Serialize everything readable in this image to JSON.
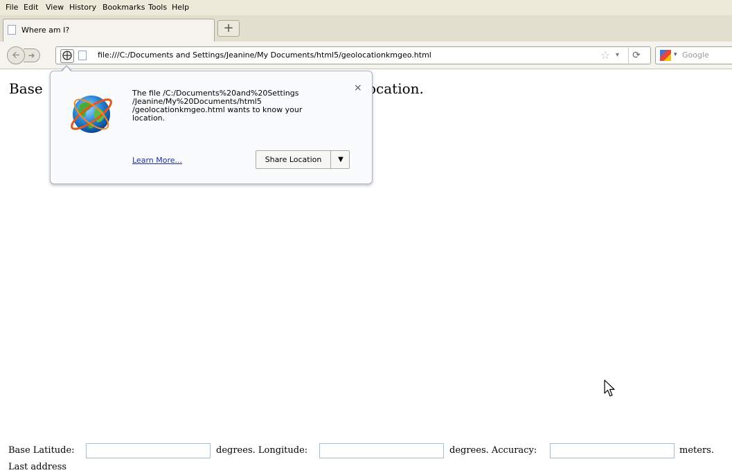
{
  "menu": {
    "items": [
      "File",
      "Edit",
      "View",
      "History",
      "Bookmarks",
      "Tools",
      "Help"
    ]
  },
  "tabs": [
    {
      "title": "Where am I?",
      "icon": "page-icon"
    }
  ],
  "new_tab": {
    "label": "+"
  },
  "nav": {
    "back_icon": "back-arrow-icon",
    "forward_icon": "forward-arrow-icon",
    "url": "file:///C:/Documents and Settings/Jeanine/My Documents/html5/geolocationkmgeo.html",
    "bookmark_icon": "star-icon",
    "reload_icon": "reload-icon",
    "search_engine": "Google"
  },
  "page": {
    "heading_left": "Base",
    "heading_right": "ocation."
  },
  "doorhanger": {
    "message_lines": [
      "The file /C:/Documents%20and%20Settings",
      "/Jeanine/My%20Documents/html5",
      "/geolocationkmgeo.html wants to know your",
      "location."
    ],
    "close_label": "×",
    "learn_more": "Learn More...",
    "share_button": "Share Location",
    "share_dropdown": "▼",
    "icon": "globe-icon"
  },
  "form": {
    "latitude_label": "Base Latitude:",
    "longitude_label": "degrees. Longitude:",
    "accuracy_label": "degrees. Accuracy:",
    "meters_label": "meters.",
    "latitude_value": "",
    "longitude_value": "",
    "accuracy_value": "",
    "last_address_label": "Last address"
  },
  "colors": {
    "menubar": "#eeead9",
    "tabstrip": "#e3dfcf",
    "link": "#1a2ea6"
  }
}
